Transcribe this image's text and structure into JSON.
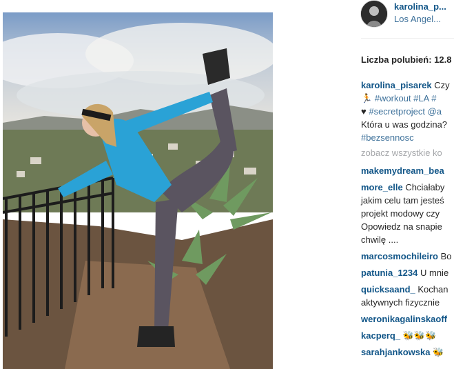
{
  "post": {
    "username": "karolina_p...",
    "location": "Los Angel...",
    "likes": "Liczba polubień: 12.8"
  },
  "caption": {
    "user": "karolina_pisarek",
    "line1_text": "Czy",
    "line2_a": "🏃",
    "line2_b": "#workout #LA #",
    "line3_a": "♥",
    "line3_b": "#secretproject @a",
    "line4": "Która u was godzina?",
    "line5": "#bezsennosc"
  },
  "view_all": "zobacz wszystkie ko",
  "comments": [
    {
      "user": "makemydream_bea",
      "lines": []
    },
    {
      "user": "more_elle",
      "lines": [
        "Chciałaby",
        "jakim celu tam jesteś",
        "projekt modowy czy",
        "Opowiedz na snapie",
        "chwilę ...."
      ]
    },
    {
      "user": "marcosmochileiro",
      "lines": [
        "Bo"
      ]
    },
    {
      "user": "patunia_1234",
      "lines": [
        "U mnie"
      ]
    },
    {
      "user": "quicksaand_",
      "lines": [
        "Kochan",
        "aktywnych fizycznie"
      ]
    },
    {
      "user": "weronikagalinskaoff",
      "lines": []
    },
    {
      "user": "kacperq_",
      "lines": [
        "🐝🐝🐝"
      ]
    },
    {
      "user": "sarahjankowska",
      "lines": [
        "🐝"
      ]
    }
  ],
  "colors": {
    "username_blue": "#125688",
    "tag_blue": "#3f729b",
    "muted_gray": "#a5a7aa"
  }
}
